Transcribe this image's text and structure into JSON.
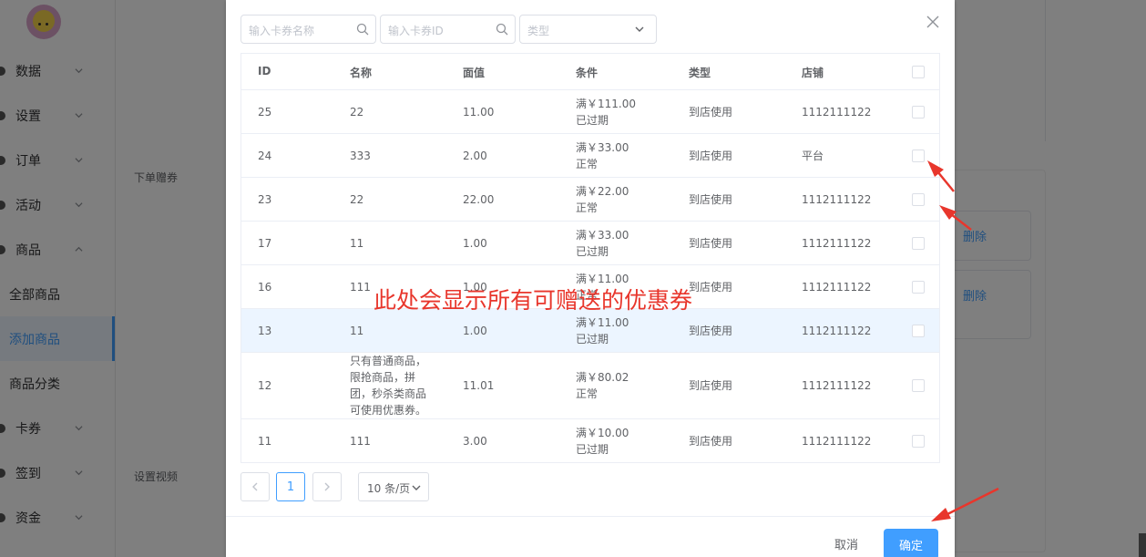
{
  "sidebar": {
    "items": [
      {
        "label": "数据"
      },
      {
        "label": "设置"
      },
      {
        "label": "订单"
      },
      {
        "label": "活动"
      },
      {
        "label": "商品"
      },
      {
        "label": "卡券"
      },
      {
        "label": "签到"
      },
      {
        "label": "资金"
      }
    ],
    "sub_items": [
      {
        "label": "全部商品"
      },
      {
        "label": "添加商品"
      },
      {
        "label": "商品分类"
      }
    ]
  },
  "form": {
    "gift_coupon_label": "下单赠券",
    "video_label": "设置视频",
    "delete_label_1": "删除",
    "delete_label_2": "删除"
  },
  "dialog": {
    "search": {
      "name_placeholder": "输入卡券名称",
      "id_placeholder": "输入卡券ID",
      "type_placeholder": "类型"
    },
    "table": {
      "headers": {
        "id": "ID",
        "name": "名称",
        "value": "面值",
        "condition": "条件",
        "type": "类型",
        "store": "店铺"
      },
      "rows": [
        {
          "id": "25",
          "name": "22",
          "value": "11.00",
          "cond1": "满￥111.00",
          "cond2": "已过期",
          "type": "到店使用",
          "store": "1112111122"
        },
        {
          "id": "24",
          "name": "333",
          "value": "2.00",
          "cond1": "满￥33.00",
          "cond2": "正常",
          "type": "到店使用",
          "store": "平台"
        },
        {
          "id": "23",
          "name": "22",
          "value": "22.00",
          "cond1": "满￥22.00",
          "cond2": "正常",
          "type": "到店使用",
          "store": "1112111122"
        },
        {
          "id": "17",
          "name": "11",
          "value": "1.00",
          "cond1": "满￥33.00",
          "cond2": "已过期",
          "type": "到店使用",
          "store": "1112111122"
        },
        {
          "id": "16",
          "name": "111",
          "value": "1.00",
          "cond1": "满￥11.00",
          "cond2": "正常",
          "type": "到店使用",
          "store": "1112111122"
        },
        {
          "id": "13",
          "name": "11",
          "value": "1.00",
          "cond1": "满￥11.00",
          "cond2": "已过期",
          "type": "到店使用",
          "store": "1112111122"
        },
        {
          "id": "12",
          "name1": "只有普通商品，",
          "name2": "限抢商品，拼",
          "name3": "团，秒杀类商品",
          "name4": "可使用优惠券。",
          "value": "11.01",
          "cond1": "满￥80.02",
          "cond2": "正常",
          "type": "到店使用",
          "store": "1112111122"
        },
        {
          "id": "11",
          "name": "111",
          "value": "3.00",
          "cond1": "满￥10.00",
          "cond2": "已过期",
          "type": "到店使用",
          "store": "1112111122"
        }
      ]
    },
    "pagination": {
      "current": "1",
      "page_size": "10 条/页"
    },
    "cancel_label": "取消",
    "confirm_label": "确定"
  },
  "annotation": {
    "text": "此处会显示所有可赠送的优惠券",
    "color": "#e8362c"
  },
  "colors": {
    "primary": "#409eff",
    "highlight_row": "#ecf5ff",
    "arrow": "#e8362c"
  }
}
